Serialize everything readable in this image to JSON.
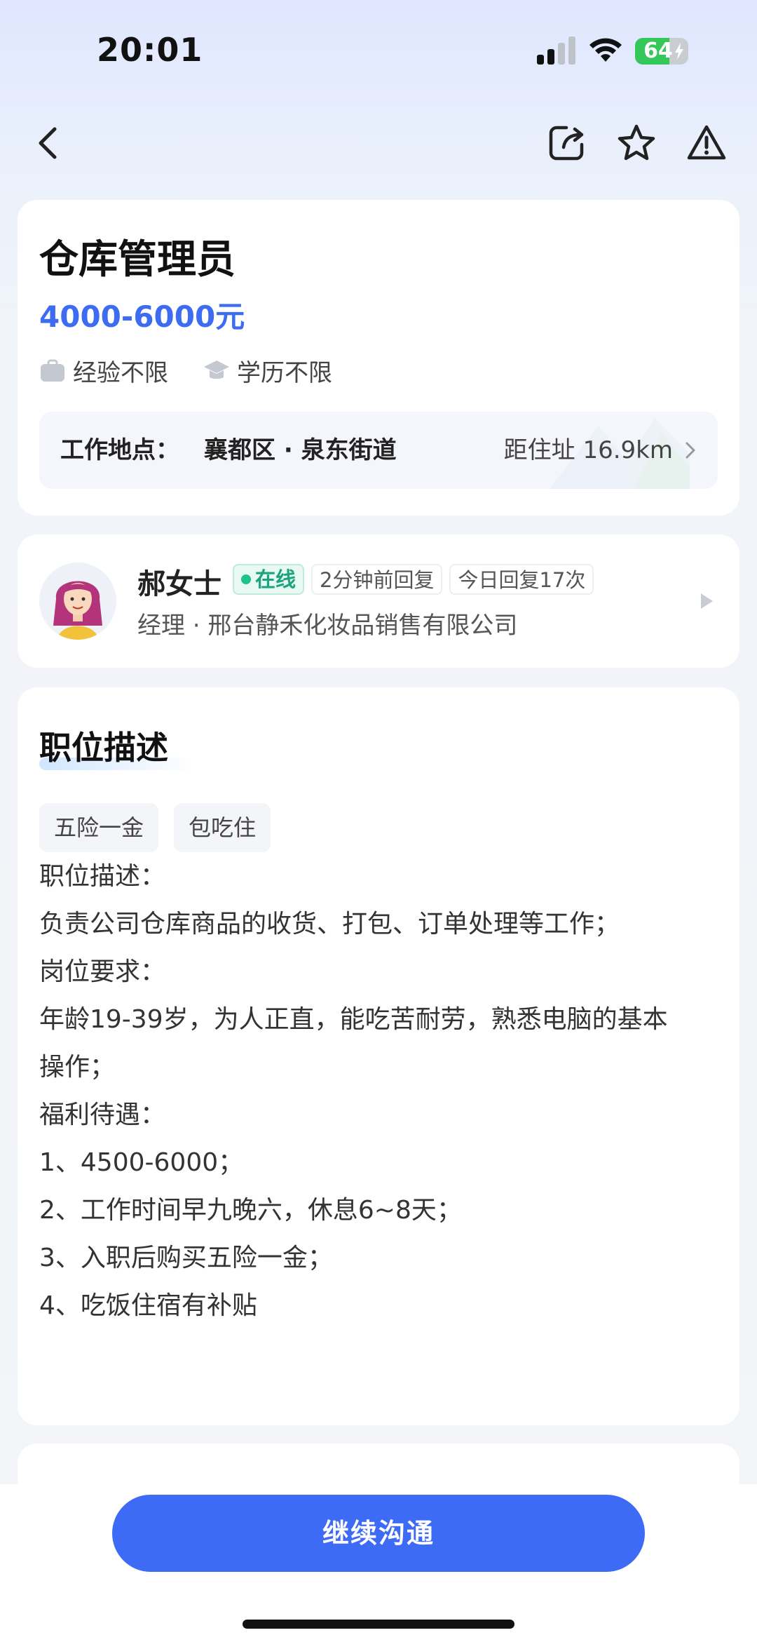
{
  "status_bar": {
    "time": "20:01",
    "battery_percent": "64",
    "battery_level": 0.64,
    "signal_bars_active": 2,
    "icons": [
      "signal-icon",
      "wifi-icon",
      "battery-icon",
      "charging-bolt-icon"
    ]
  },
  "nav": {
    "icons": [
      "back-arrow-icon",
      "share-icon",
      "star-icon",
      "report-warning-icon"
    ]
  },
  "job": {
    "title": "仓库管理员",
    "salary": "4000-6000元",
    "experience": "经验不限",
    "education": "学历不限",
    "location_label": "工作地点：",
    "location_value": "襄都区 · 泉东街道",
    "distance": "距住址 16.9km"
  },
  "recruiter": {
    "name": "郝女士",
    "online": "在线",
    "reply_time": "2分钟前回复",
    "reply_count": "今日回复17次",
    "company": "经理 · 邢台静禾化妆品销售有限公司"
  },
  "description": {
    "section_title": "职位描述",
    "tags": [
      "五险一金",
      "包吃住"
    ],
    "lines": [
      "职位描述：",
      "负责公司仓库商品的收货、打包、订单处理等工作；",
      "岗位要求：",
      "年龄19-39岁，为人正直，能吃苦耐劳，熟悉电脑的基本",
      "操作；",
      "福利待遇：",
      "1、4500-6000；",
      "2、工作时间早九晚六，休息6~8天；",
      "3、入职后购买五险一金；",
      "4、吃饭住宿有补贴"
    ]
  },
  "cta": {
    "label": "继续沟通"
  },
  "colors": {
    "accent": "#3d6bf5",
    "salary": "#3d6bf2",
    "online": "#1aa47d",
    "battery": "#34c759"
  }
}
